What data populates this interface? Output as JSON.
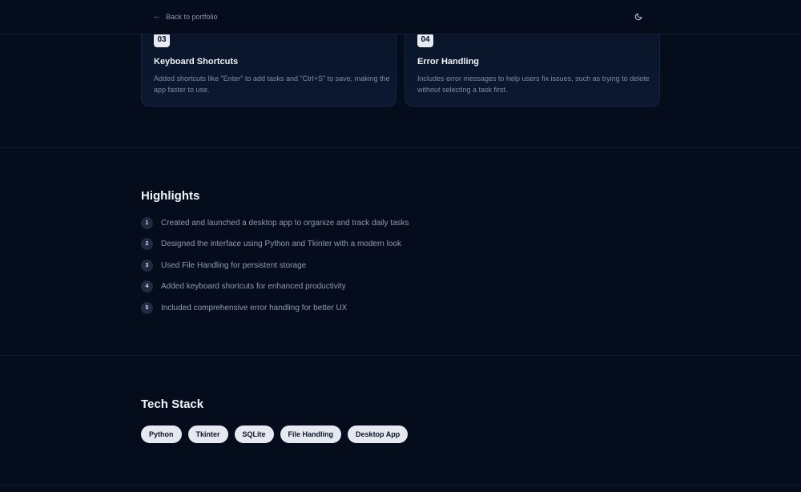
{
  "header": {
    "back_label": "Back to portfolio",
    "back_icon": "arrow-left-icon",
    "theme_icon": "moon-icon"
  },
  "features": [
    {
      "number": "03",
      "title": "Keyboard Shortcuts",
      "description": "Added shortcuts like \"Enter\" to add tasks and \"Ctrl+S\" to save, making the app faster to use."
    },
    {
      "number": "04",
      "title": "Error Handling",
      "description": "Includes error messages to help users fix issues, such as trying to delete without selecting a task first."
    }
  ],
  "highlights": {
    "title": "Highlights",
    "items": [
      {
        "num": "1",
        "text": "Created and launched a desktop app to organize and track daily tasks"
      },
      {
        "num": "2",
        "text": "Designed the interface using Python and Tkinter with a modern look"
      },
      {
        "num": "3",
        "text": "Used File Handling for persistent storage"
      },
      {
        "num": "4",
        "text": "Added keyboard shortcuts for enhanced productivity"
      },
      {
        "num": "5",
        "text": "Included comprehensive error handling for better UX"
      }
    ]
  },
  "tech_stack": {
    "title": "Tech Stack",
    "chips": [
      "Python",
      "Tkinter",
      "SQLite",
      "File Handling",
      "Desktop App"
    ]
  },
  "colors": {
    "background": "#050c1c",
    "card_border": "#172441",
    "chip_background": "#e6eaf0",
    "muted_text": "#8f9bb0"
  }
}
